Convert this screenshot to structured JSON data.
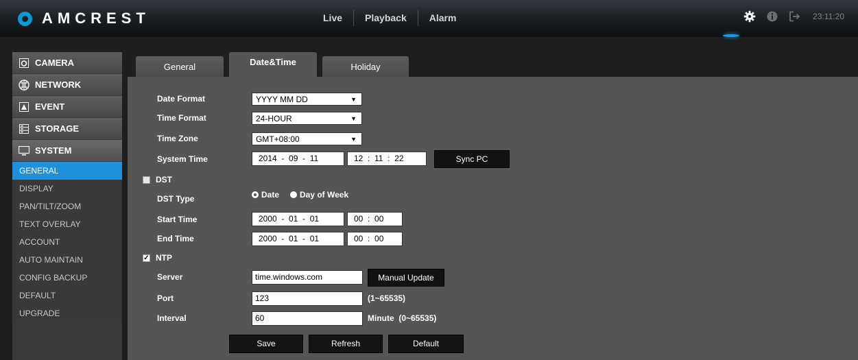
{
  "header": {
    "brand": "AMCREST",
    "nav": [
      "Live",
      "Playback",
      "Alarm"
    ],
    "icons": [
      "gear-icon",
      "info-icon",
      "logout-icon"
    ],
    "clock": "23:11:20",
    "accent": "#1a9be0"
  },
  "sidebar": {
    "categories": [
      {
        "label": "CAMERA",
        "icon": "camera-icon"
      },
      {
        "label": "NETWORK",
        "icon": "network-icon"
      },
      {
        "label": "EVENT",
        "icon": "event-icon"
      },
      {
        "label": "STORAGE",
        "icon": "storage-icon"
      },
      {
        "label": "SYSTEM",
        "icon": "monitor-icon"
      }
    ],
    "system_items": [
      "GENERAL",
      "DISPLAY",
      "PAN/TILT/ZOOM",
      "TEXT OVERLAY",
      "ACCOUNT",
      "AUTO MAINTAIN",
      "CONFIG BACKUP",
      "DEFAULT",
      "UPGRADE"
    ],
    "active_item": "GENERAL"
  },
  "tabs": [
    "General",
    "Date&Time",
    "Holiday"
  ],
  "active_tab": "Date&Time",
  "form": {
    "date_format": {
      "label": "Date Format",
      "value": "YYYY MM DD"
    },
    "time_format": {
      "label": "Time Format",
      "value": "24-HOUR"
    },
    "time_zone": {
      "label": "Time Zone",
      "value": "GMT+08:00"
    },
    "system_time": {
      "label": "System Time",
      "date": "2014  -  09  -  11",
      "time": "12  :  11  :  22",
      "sync_label": "Sync PC"
    },
    "dst": {
      "label": "DST",
      "checked": false
    },
    "dst_type": {
      "label": "DST Type",
      "options": [
        "Date",
        "Day of Week"
      ],
      "selected": "Date"
    },
    "start_time": {
      "label": "Start Time",
      "date": "2000  -  01  -  01",
      "time": "00  :  00"
    },
    "end_time": {
      "label": "End Time",
      "date": "2000  -  01  -  01",
      "time": "00  :  00"
    },
    "ntp": {
      "label": "NTP",
      "checked": true
    },
    "server": {
      "label": "Server",
      "value": "time.windows.com",
      "button": "Manual Update"
    },
    "port": {
      "label": "Port",
      "value": "123",
      "hint": "(1~65535)"
    },
    "interval": {
      "label": "Interval",
      "value": "60",
      "hint": "Minute  (0~65535)"
    }
  },
  "actions": {
    "save": "Save",
    "refresh": "Refresh",
    "default": "Default"
  }
}
